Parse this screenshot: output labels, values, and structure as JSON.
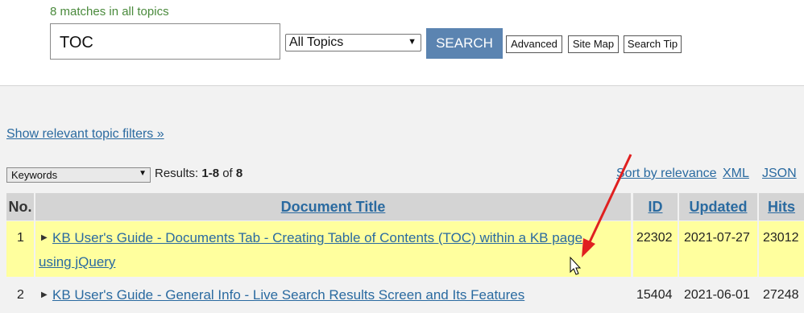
{
  "search": {
    "match_text": "8 matches in all topics",
    "query": "TOC",
    "topic": "All Topics",
    "search_label": "SEARCH",
    "advanced_label": "Advanced",
    "sitemap_label": "Site Map",
    "tip_label": "Search Tip"
  },
  "filters": {
    "show_filters": "Show relevant topic filters »",
    "sort_field": "Keywords",
    "results_prefix": "Results: ",
    "results_range": "1-8",
    "results_of": " of ",
    "results_total": "8",
    "sort_relevance": "Sort by relevance",
    "xml": "XML",
    "json": "JSON"
  },
  "table": {
    "headers": {
      "no": "No.",
      "title": "Document Title",
      "id": "ID",
      "updated": "Updated",
      "hits": "Hits"
    },
    "rows": [
      {
        "no": "1",
        "title_line1": "KB User's Guide - Documents Tab - Creating Table of Contents (TOC) within a KB page",
        "title_line2": "using jQuery",
        "id": "22302",
        "updated": "2021-07-27",
        "hits": "23012"
      },
      {
        "no": "2",
        "title_line1": "KB User's Guide - General Info - Live Search Results Screen and Its Features",
        "id": "15404",
        "updated": "2021-06-01",
        "hits": "27248"
      }
    ]
  },
  "colors": {
    "link": "#2a6aa0",
    "highlight_row": "#ffff9e",
    "search_button": "#5b84b1",
    "arrow": "#e02020"
  }
}
